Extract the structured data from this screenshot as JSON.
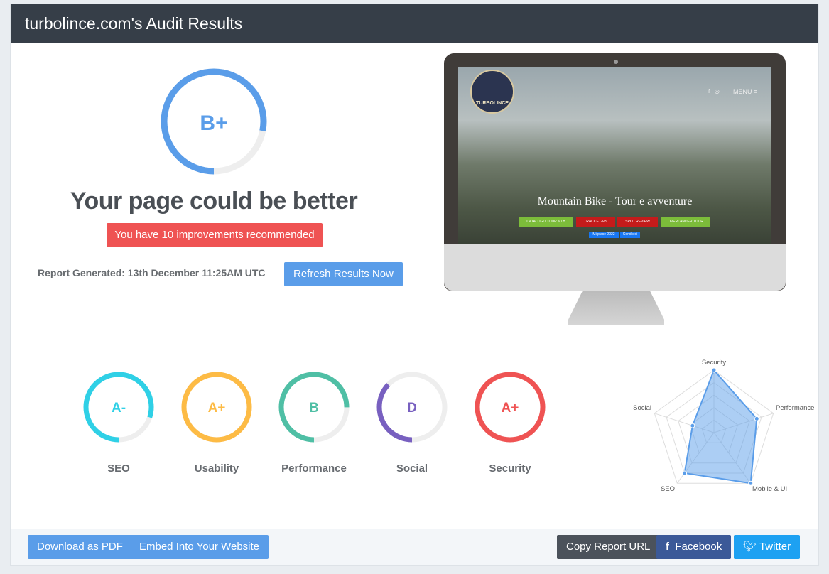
{
  "header": {
    "title": "turbolince.com's Audit Results"
  },
  "overall": {
    "grade": "B+",
    "score_percent": 78,
    "color": "#5a9de9",
    "headline": "Your page could be better",
    "improvements_badge": "You have 10 improvements recommended",
    "report_generated": "Report Generated: 13th December 11:25AM UTC",
    "refresh_label": "Refresh Results Now"
  },
  "preview": {
    "site_title": "Mountain Bike - Tour e avventure",
    "menu_label": "MENU ≡",
    "logo_text": "TURBOLINCE",
    "buttons": [
      "CATALOGO TOUR MTB",
      "TRACCE GPS",
      "SPOT REVIEW",
      "OVERLANDER TOUR"
    ],
    "like_label": "Mi piace 2022",
    "share_label": "Condividi"
  },
  "categories": [
    {
      "label": "SEO",
      "grade": "A-",
      "percent": 80,
      "color": "#2fd0e6"
    },
    {
      "label": "Usability",
      "grade": "A+",
      "percent": 100,
      "color": "#fdbb45"
    },
    {
      "label": "Performance",
      "grade": "B",
      "percent": 75,
      "color": "#4fbfa5"
    },
    {
      "label": "Social",
      "grade": "D",
      "percent": 37,
      "color": "#7860c0"
    },
    {
      "label": "Security",
      "grade": "A+",
      "percent": 100,
      "color": "#ef5353"
    }
  ],
  "chart_data": {
    "type": "radar",
    "axes": [
      "Security",
      "Performance",
      "Mobile & UI",
      "SEO",
      "Social"
    ],
    "values": [
      100,
      72,
      100,
      80,
      36
    ],
    "range": [
      0,
      100
    ],
    "color": "#5a9de9"
  },
  "footer": {
    "pdf": "Download as PDF",
    "embed": "Embed Into Your Website",
    "copy": "Copy Report URL",
    "facebook": "Facebook",
    "twitter": "Twitter"
  }
}
